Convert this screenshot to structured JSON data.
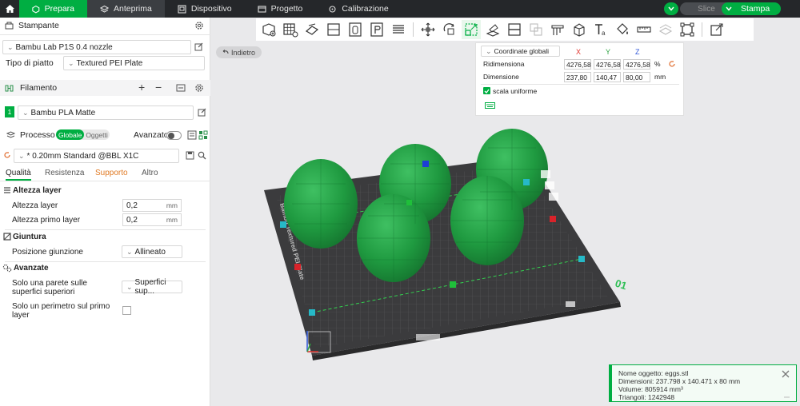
{
  "topbar": {
    "tabs": [
      {
        "label": "Prepara",
        "icon": "prepare-icon"
      },
      {
        "label": "Anteprima",
        "icon": "preview-icon"
      },
      {
        "label": "Dispositivo",
        "icon": "device-icon"
      },
      {
        "label": "Progetto",
        "icon": "project-icon"
      },
      {
        "label": "Calibrazione",
        "icon": "calibration-icon"
      }
    ],
    "slice_label": "Slice",
    "print_label": "Stampa"
  },
  "sidebar": {
    "printer": {
      "title": "Stampante",
      "printer_name": "Bambu Lab P1S 0.4 nozzle",
      "plate_label": "Tipo di piatto",
      "plate_value": "Textured PEI Plate"
    },
    "filament": {
      "title": "Filamento",
      "slot_number": "1",
      "filament_name": "Bambu PLA Matte"
    },
    "process": {
      "title": "Processo",
      "toggle_global": "Globale",
      "toggle_objects": "Oggetti",
      "advanced_label": "Avanzato",
      "preset": "* 0.20mm Standard @BBL X1C"
    },
    "subtabs": [
      "Qualità",
      "Resistenza",
      "Supporto",
      "Altro"
    ],
    "layer_height": {
      "section": "Altezza layer",
      "layer_label": "Altezza layer",
      "layer_value": "0,2",
      "first_label": "Altezza primo layer",
      "first_value": "0,2",
      "unit": "mm"
    },
    "seam": {
      "section": "Giuntura",
      "position_label": "Posizione giunzione",
      "position_value": "Allineato"
    },
    "advanced": {
      "section": "Avanzate",
      "top_wall_label_1": "Solo una parete sulle",
      "top_wall_label_2": "superfici superiori",
      "top_wall_value": "Superfici sup...",
      "first_perimeter_label_1": "Solo un perimetro sul primo",
      "first_perimeter_label_2": "layer"
    }
  },
  "viewport": {
    "back_label": "Indietro",
    "coordinates": {
      "dropdown": "Coordinate globali",
      "axis_x": "X",
      "axis_y": "Y",
      "axis_z": "Z",
      "scale_label": "Ridimensiona",
      "scale_x": "4276,58",
      "scale_y": "4276,58",
      "scale_z": "4276,58",
      "scale_unit": "%",
      "size_label": "Dimensione",
      "size_x": "237,80",
      "size_y": "140,47",
      "size_z": "80,00",
      "size_unit": "mm",
      "uniform_label": "scala uniforme"
    },
    "plate_number": "01",
    "plate_text": "Bambu Textured PEI Plate",
    "info": {
      "name": "Nome oggetto: eggs.stl",
      "dims": "Dimensioni: 237.798 x 140.471 x 80 mm",
      "volume": "Volume: 805914 mm³",
      "triangles": "Triangoli: 1242948"
    }
  },
  "colors": {
    "accent": "#00ae42",
    "topbar": "#25272a",
    "object": "#1f9a40",
    "plate": "#3a3a3c"
  }
}
